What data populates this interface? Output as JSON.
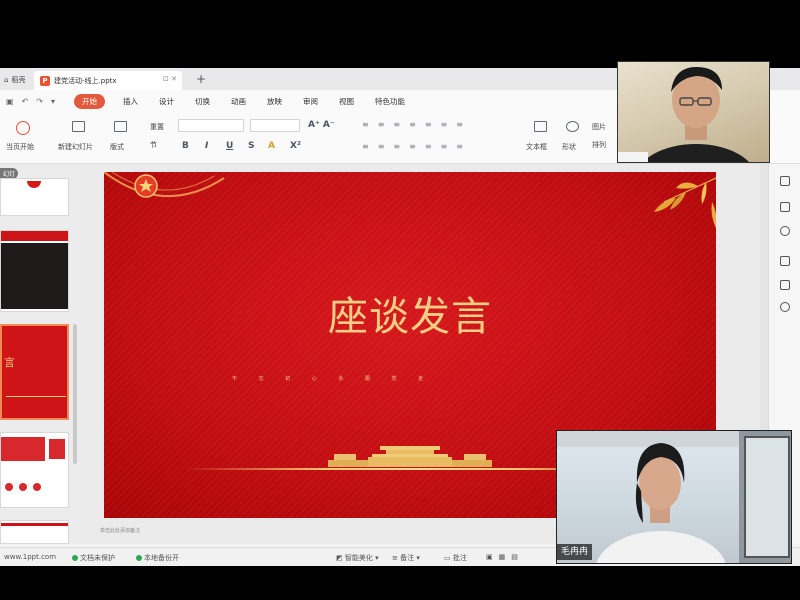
{
  "window": {
    "home_tab": "稻壳",
    "doc_tab": "建党活动-线上.pptx",
    "new_tab": "+"
  },
  "menu": {
    "items": [
      "开始",
      "插入",
      "设计",
      "切换",
      "动画",
      "放映",
      "审阅",
      "视图",
      "特色功能"
    ],
    "active_index": 0
  },
  "ribbon": {
    "from_current": "当页开始",
    "new_slide": "新建幻灯片",
    "layout": "版式",
    "section": "节",
    "reset": "重置",
    "text_box": "文本框",
    "shape": "形状",
    "picture": "图片",
    "arrange": "排列"
  },
  "slide": {
    "title": "座谈发言",
    "subtitle": "不 忘 初 心 永 跟 党 走"
  },
  "thumbnails": {
    "third_text": "言"
  },
  "left_tag": "幻灯",
  "notes_placeholder": "单击此处添加备注",
  "status": {
    "website": "www.1ppt.com",
    "doc_protect": "文档未保护",
    "backup": "本地备份开",
    "beautify": "智能美化",
    "notes": "备注",
    "comments": "批注"
  },
  "participant": {
    "name": "毛冉冉"
  },
  "colors": {
    "accent": "#e25a3e",
    "slide_red": "#c8101a",
    "gold": "#f2cf84"
  }
}
